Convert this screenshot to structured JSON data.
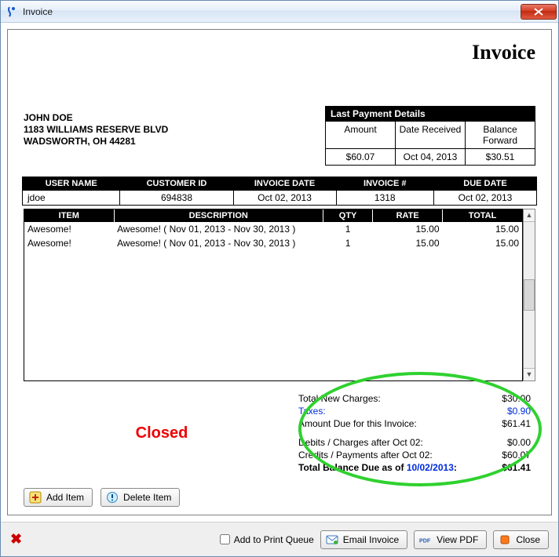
{
  "window": {
    "title": "Invoice"
  },
  "document": {
    "title": "Invoice",
    "address": {
      "name": "JOHN DOE",
      "line1": "1183 WILLIAMS RESERVE BLVD",
      "line2": "WADSWORTH, OH 44281"
    },
    "last_payment": {
      "heading": "Last Payment Details",
      "headers": {
        "amount": "Amount",
        "date": "Date Received",
        "balance": "Balance Forward"
      },
      "values": {
        "amount": "$60.07",
        "date": "Oct 04, 2013",
        "balance": "$30.51"
      }
    },
    "meta": {
      "headers": {
        "user": "USER NAME",
        "customer": "CUSTOMER ID",
        "inv_date": "INVOICE DATE",
        "inv_no": "INVOICE #",
        "due": "DUE DATE"
      },
      "values": {
        "user": "jdoe",
        "customer": "694838",
        "inv_date": "Oct 02, 2013",
        "inv_no": "1318",
        "due": "Oct 02, 2013"
      }
    },
    "lines": {
      "headers": {
        "item": "ITEM",
        "desc": "DESCRIPTION",
        "qty": "QTY",
        "rate": "RATE",
        "total": "TOTAL"
      },
      "rows": [
        {
          "item": "Awesome!",
          "desc": "Awesome! ( Nov 01, 2013 - Nov 30, 2013 )",
          "qty": "1",
          "rate": "15.00",
          "total": "15.00"
        },
        {
          "item": "Awesome!",
          "desc": "Awesome! ( Nov 01, 2013 - Nov 30, 2013 )",
          "qty": "1",
          "rate": "15.00",
          "total": "15.00"
        }
      ]
    },
    "status": "Closed",
    "totals": {
      "new_charges": {
        "label": "Total New Charges:",
        "value": "$30.00"
      },
      "taxes": {
        "label": "Taxes:",
        "value": "$0.90"
      },
      "amount_due": {
        "label": "Amount Due for this Invoice:",
        "value": "$61.41"
      },
      "debits": {
        "label": "Debits / Charges after Oct 02:",
        "value": "$0.00"
      },
      "credits": {
        "label": "Credits / Payments after Oct 02:",
        "value": "$60.07"
      },
      "balance": {
        "label_prefix": "Total Balance Due as of ",
        "date": "10/02/2013",
        "label_suffix": ":",
        "value": "$61.41"
      }
    }
  },
  "buttons": {
    "add_item": "Add Item",
    "delete_item": "Delete Item",
    "add_queue": "Add to Print Queue",
    "email": "Email Invoice",
    "view_pdf": "View PDF",
    "close": "Close"
  }
}
